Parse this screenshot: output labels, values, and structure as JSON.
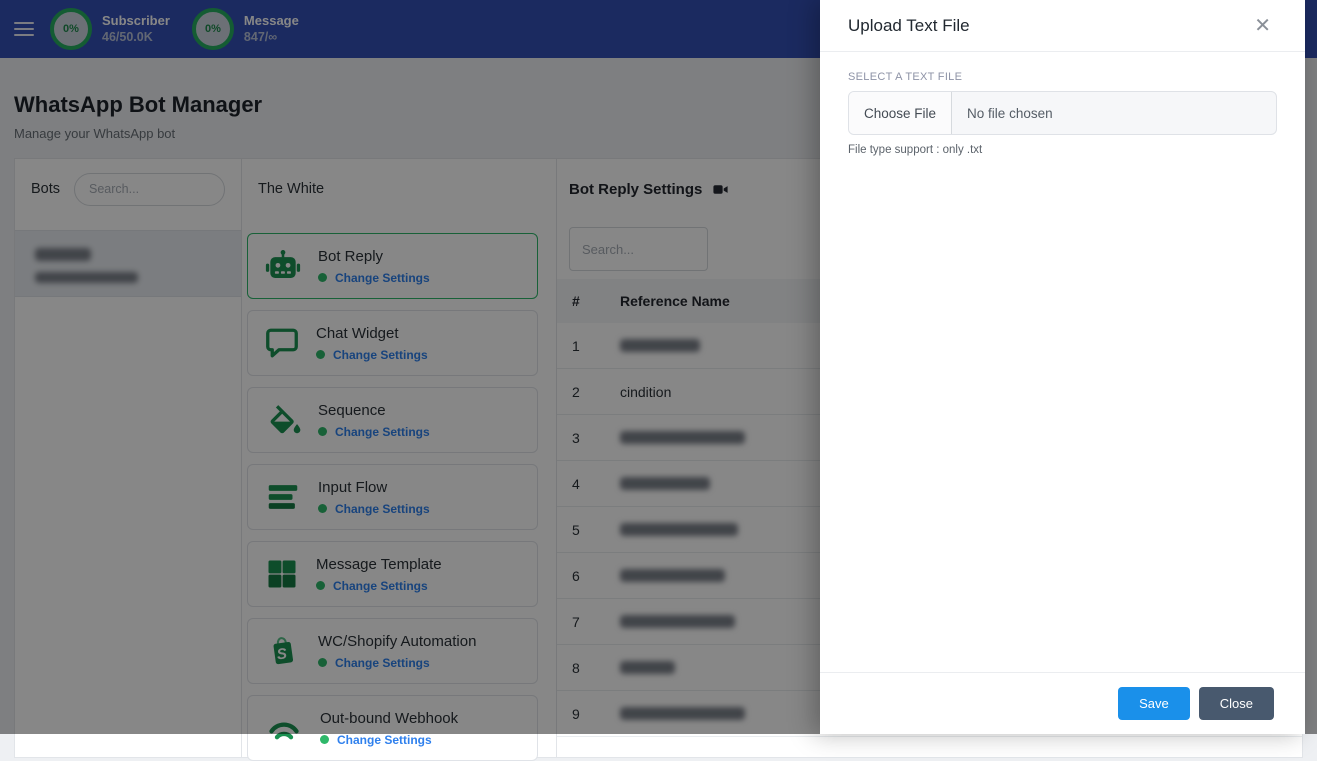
{
  "navbar": {
    "subscriber": {
      "percent": "0%",
      "label": "Subscriber",
      "count": "46/50.0K"
    },
    "message": {
      "percent": "0%",
      "label": "Message",
      "count": "847/∞"
    }
  },
  "page": {
    "title": "WhatsApp Bot Manager",
    "subtitle": "Manage your WhatsApp bot"
  },
  "bots_panel": {
    "title": "Bots",
    "search_placeholder": "Search...",
    "items": [
      {
        "name_redacted": true,
        "phone_redacted": true,
        "selected": true
      }
    ]
  },
  "bot_panel": {
    "title": "The White",
    "cards": [
      {
        "title": "Bot Reply",
        "link": "Change Settings",
        "icon": "robot-icon",
        "selected": true
      },
      {
        "title": "Chat Widget",
        "link": "Change Settings",
        "icon": "chat-bubble-icon",
        "selected": false
      },
      {
        "title": "Sequence",
        "link": "Change Settings",
        "icon": "paint-bucket-icon",
        "selected": false
      },
      {
        "title": "Input Flow",
        "link": "Change Settings",
        "icon": "bars-icon",
        "selected": false
      },
      {
        "title": "Message Template",
        "link": "Change Settings",
        "icon": "grid-icon",
        "selected": false
      },
      {
        "title": "WC/Shopify Automation",
        "link": "Change Settings",
        "icon": "shopify-icon",
        "selected": false
      },
      {
        "title": "Out-bound Webhook",
        "link": "Change Settings",
        "icon": "webhook-icon",
        "selected": false
      }
    ]
  },
  "settings_panel": {
    "title": "Bot Reply Settings",
    "title_icon": "video-camera-icon",
    "search_placeholder": "Search...",
    "table": {
      "headers": [
        "#",
        "Reference Name"
      ],
      "rows": [
        {
          "num": "1",
          "name": "",
          "redacted": true
        },
        {
          "num": "2",
          "name": "cindition",
          "redacted": false
        },
        {
          "num": "3",
          "name": "",
          "redacted": true
        },
        {
          "num": "4",
          "name": "",
          "redacted": true
        },
        {
          "num": "5",
          "name": "",
          "redacted": true
        },
        {
          "num": "6",
          "name": "",
          "redacted": true
        },
        {
          "num": "7",
          "name": "",
          "redacted": true
        },
        {
          "num": "8",
          "name": "",
          "redacted": true
        },
        {
          "num": "9",
          "name": "",
          "redacted": true
        }
      ]
    }
  },
  "modal": {
    "title": "Upload Text File",
    "close_icon": "✕",
    "field_label": "SELECT A TEXT FILE",
    "file_button": "Choose File",
    "file_status": "No file chosen",
    "hint": "File type support : only .txt",
    "save_label": "Save",
    "close_label": "Close"
  },
  "colors": {
    "navbar_indigo": "#3450b5",
    "accent_green": "#1b9152",
    "status_dot_green": "#2eb86a",
    "link_blue": "#2f80ed",
    "save_blue": "#1a90ea",
    "close_slate": "#48596e",
    "ring_green": "#27ae60"
  }
}
